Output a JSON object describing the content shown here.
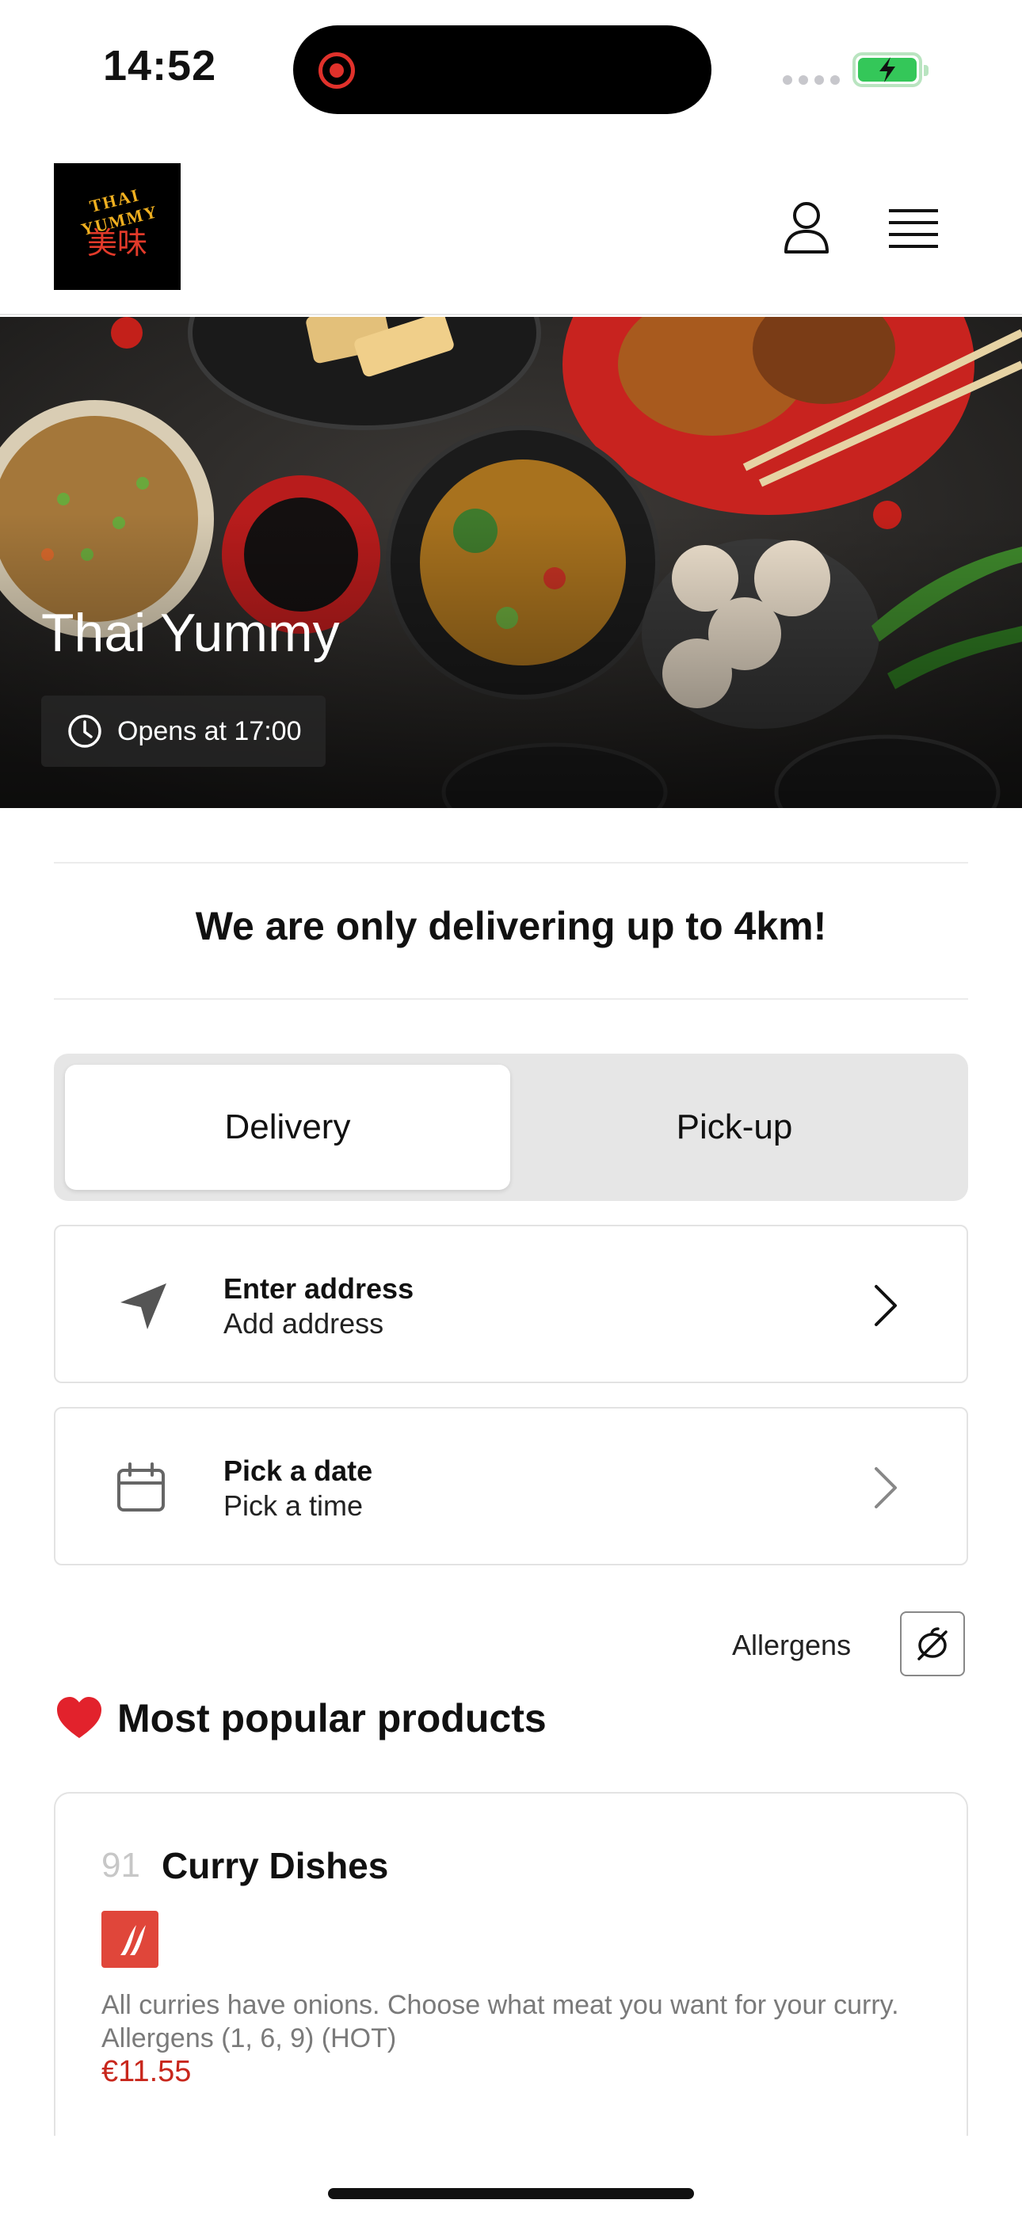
{
  "status_bar": {
    "time": "14:52",
    "icons": [
      "screen-recording-icon",
      "signal-icon",
      "battery-charging-icon"
    ]
  },
  "header": {
    "logo_text": "THAI YUMMY",
    "logo_chinese": "美味",
    "icons": [
      "user-icon",
      "menu-icon"
    ]
  },
  "hero": {
    "restaurant_name": "Thai Yummy",
    "hours": "Opens at 17:00"
  },
  "notice": "We are only delivering up to 4km!",
  "order_type": {
    "options": [
      "Delivery",
      "Pick-up"
    ],
    "selected": "Delivery"
  },
  "address_row": {
    "title": "Enter address",
    "subtitle": "Add address"
  },
  "date_row": {
    "title": "Pick a date",
    "subtitle": "Pick a time"
  },
  "allergens_label": "Allergens",
  "section": {
    "title": "Most popular products"
  },
  "products": [
    {
      "number": "91",
      "name": "Curry Dishes",
      "description": "All curries have onions. Choose what meat you want for your curry. Allergens (1, 6, 9) (HOT)",
      "price": "€11.55"
    }
  ],
  "colors": {
    "accent_red": "#c8271c",
    "spicy_badge": "#e0463a",
    "battery_green": "#34c759"
  }
}
